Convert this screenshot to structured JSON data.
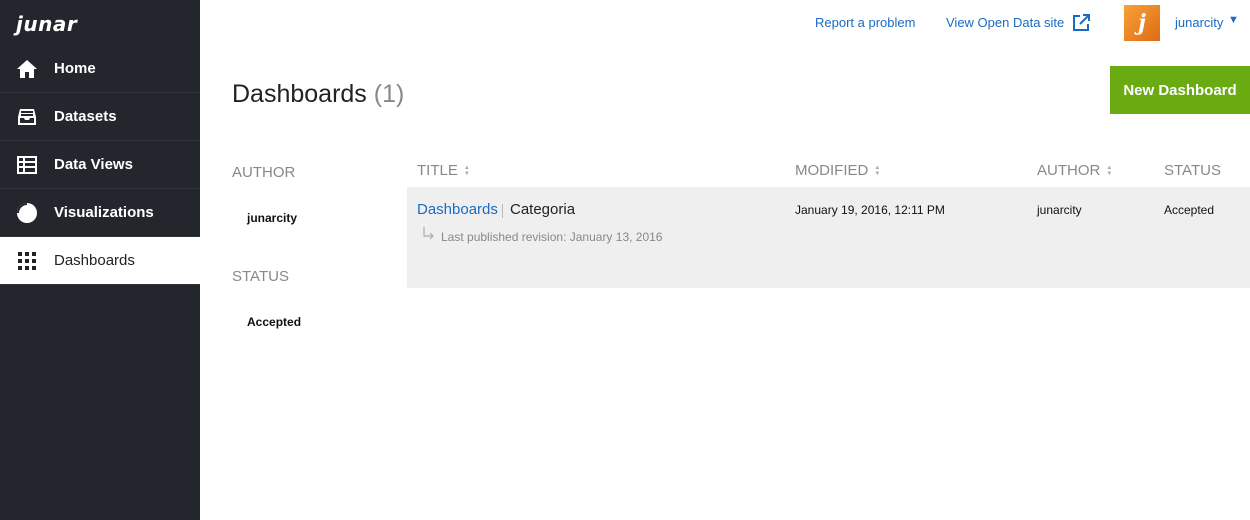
{
  "app": {
    "logo_text": "junar"
  },
  "sidebar": {
    "items": [
      {
        "label": "Home",
        "icon": "home-icon",
        "active": false
      },
      {
        "label": "Datasets",
        "icon": "inbox-icon",
        "active": false
      },
      {
        "label": "Data Views",
        "icon": "table-icon",
        "active": false
      },
      {
        "label": "Visualizations",
        "icon": "pie-chart-icon",
        "active": false
      },
      {
        "label": "Dashboards",
        "icon": "grid-icon",
        "active": true
      }
    ]
  },
  "header": {
    "report_link": "Report a problem",
    "open_data_link": "View Open Data site",
    "user_name": "junarcity",
    "user_caret": "▼"
  },
  "main": {
    "title": "Dashboards",
    "count": "(1)",
    "new_button": "New Dashboard"
  },
  "filters": {
    "author_heading": "AUTHOR",
    "author_value": "junarcity",
    "status_heading": "STATUS",
    "status_value": "Accepted"
  },
  "table": {
    "columns": [
      "TITLE",
      "MODIFIED",
      "AUTHOR",
      "STATUS"
    ],
    "rows": [
      {
        "title": "Dashboards",
        "category": "Categoria",
        "revision": "Last published revision: January 13, 2016",
        "modified": "January 19, 2016, 12:11 PM",
        "author": "junarcity",
        "status": "Accepted"
      }
    ]
  },
  "colors": {
    "sidebar_bg": "#23272d",
    "accent_green": "#6aab12",
    "link_blue": "#1a6bc2",
    "row_bg": "#efefef"
  }
}
